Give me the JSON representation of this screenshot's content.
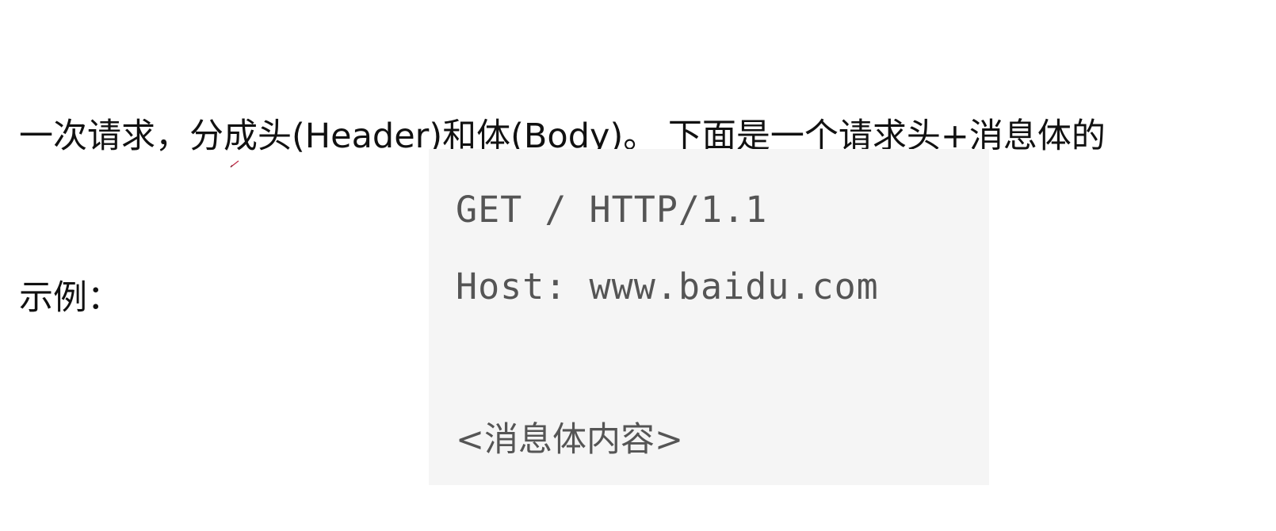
{
  "intro": {
    "line1": "一次请求，分成头(Header)和体(Body)。 下面是一个请求头+消息体的",
    "line2": "示例："
  },
  "code_example": {
    "lines": [
      "GET / HTTP/1.1",
      "Host: www.baidu.com",
      "",
      "<消息体内容>"
    ]
  },
  "colors": {
    "code_background": "#f5f5f5",
    "code_text": "#555555",
    "body_text": "#111111",
    "cursor_mark": "#c0304a"
  }
}
